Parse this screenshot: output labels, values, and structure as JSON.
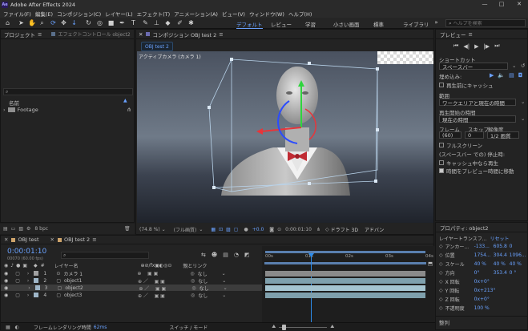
{
  "window": {
    "title": "Adobe After Effects 2024",
    "app_badge": "Ae",
    "min": "—",
    "max": "□",
    "close": "✕"
  },
  "menu": [
    "ファイル(F)",
    "編集(E)",
    "コンポジション(C)",
    "レイヤー(L)",
    "エフェクト(T)",
    "アニメーション(A)",
    "ビュー(V)",
    "ウィンドウ(W)",
    "ヘルプ(H)"
  ],
  "workspaces": [
    "デフォルト",
    "レビュー",
    "学習",
    "小さい画面",
    "標準",
    "ライブラリ"
  ],
  "help_search": {
    "placeholder": "ヘルプを検索"
  },
  "project": {
    "tab": "プロジェクト",
    "effect_tab": "エフェクトコントロール object2",
    "search_placeholder": "",
    "col_name": "名前",
    "items": [
      {
        "name": "Footage"
      }
    ]
  },
  "composition": {
    "panel_tab": "コンポジション OBJ test 2",
    "breadcrumb": "OBJ test 2",
    "view_label": "アクティブカメラ (カメラ 1)",
    "zoom": "(74.8 %)",
    "quality": "(フル画質)",
    "exposure": "+0.0",
    "timecode": "0:00:01:10",
    "renderer": "ドラフト 3D",
    "renderer2": "アドバン"
  },
  "preview": {
    "tab": "プレビュー",
    "shortcut_label": "ショートカット",
    "shortcut_value": "スペースバー",
    "include_label": "埋め込み:",
    "cache_before": "再生前にキャッシュ",
    "range_label": "範囲",
    "range_value": "ワークエリアと現在の時間",
    "play_from_label": "再生開始の時間",
    "play_from_value": "現在の時間",
    "frame_label": "フレーム",
    "skip_label": "スキップ",
    "resolution_label": "解像度",
    "frame_value": "(60)",
    "skip_value": "0",
    "resolution_value": "1/2 画質",
    "fullscreen": "フルスクリーン",
    "stop_label": "(スペースバー での) 停止時:",
    "cache_playing": "キャッシュ中なら再生",
    "move_time": "時間をプレビュー時間に移動"
  },
  "properties": {
    "tab": "プロパティ: object2",
    "transform_label": "レイヤートランスフ...",
    "reset": "リセット",
    "rows": [
      {
        "name": "アンカー...",
        "v1": "-133...",
        "v2": "605.8",
        "v3": "0"
      },
      {
        "name": "位置",
        "v1": "1754...",
        "v2": "304.4",
        "v3": "1096..."
      },
      {
        "name": "スケール",
        "v1": "40 %",
        "v2": "40 %",
        "v3": "40 %"
      },
      {
        "name": "方向",
        "v1": "0°",
        "v2": "353.4",
        "v3": "0 °"
      },
      {
        "name": "X 回転",
        "v1": "0x+0°",
        "v2": "",
        "v3": ""
      },
      {
        "name": "Y 回転",
        "v1": "0x+213°",
        "v2": "",
        "v3": ""
      },
      {
        "name": "Z 回転",
        "v1": "0x+0°",
        "v2": "",
        "v3": ""
      },
      {
        "name": "不透明度",
        "v1": "100 %",
        "v2": "",
        "v3": ""
      }
    ],
    "align_tab": "整列"
  },
  "timeline": {
    "tabs": [
      "OBJ test",
      "OBJ test 2"
    ],
    "timecode": "0:00:01:10",
    "frame_info": "00070 (60.00 fps)",
    "col_layer": "レイヤー名",
    "col_parent": "親とリンク",
    "ruler": [
      "00s",
      "01s",
      "02s",
      "03s",
      "04s"
    ],
    "layers": [
      {
        "num": "1",
        "name": "カメラ 1",
        "parent": "なし",
        "color": "#a1a1a1"
      },
      {
        "num": "2",
        "name": "object1",
        "parent": "なし",
        "color": "#9fb6c8"
      },
      {
        "name": "object2",
        "num": "3",
        "parent": "なし",
        "color": "#9fb6c8"
      },
      {
        "num": "4",
        "name": "object3",
        "parent": "なし",
        "color": "#9fb6c8"
      }
    ],
    "render_time_label": "フレームレンダリング時間",
    "render_time": "62ms",
    "switch_mode": "スイッチ / モード"
  },
  "bpc": "8 bpc",
  "colors": {
    "accent": "#2d8ceb",
    "bg": "#1d1d1d",
    "panel": "#232323"
  }
}
